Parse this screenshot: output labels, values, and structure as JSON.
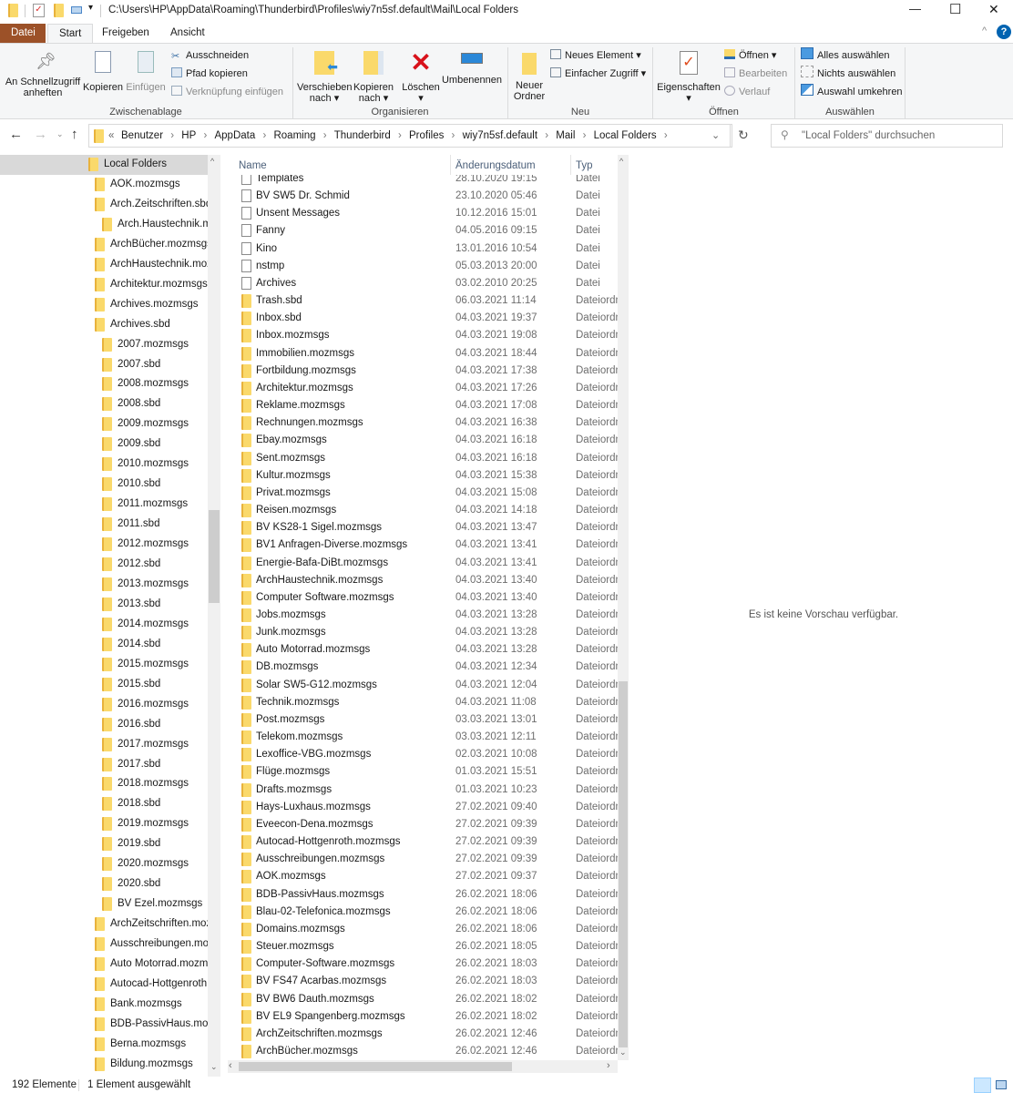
{
  "window": {
    "title": "C:\\Users\\HP\\AppData\\Roaming\\Thunderbird\\Profiles\\wiy7n5sf.default\\Mail\\Local Folders",
    "controls": {
      "minimize": "—",
      "maximize": "☐",
      "close": "✕"
    }
  },
  "ribbon_tabs": [
    {
      "label": "Datei"
    },
    {
      "label": "Start"
    },
    {
      "label": "Freigeben"
    },
    {
      "label": "Ansicht"
    }
  ],
  "ribbon": {
    "clipboard": {
      "pin": "An Schnellzugriff anheften",
      "copy": "Kopieren",
      "paste": "Einfügen",
      "cut": "Ausschneiden",
      "copy_path": "Pfad kopieren",
      "paste_shortcut": "Verknüpfung einfügen",
      "group": "Zwischenablage"
    },
    "organize": {
      "move_to": "Verschieben nach",
      "copy_to": "Kopieren nach",
      "delete": "Löschen",
      "rename": "Umbenennen",
      "group": "Organisieren"
    },
    "new": {
      "new_folder": "Neuer Ordner",
      "new_item": "Neues Element",
      "easy_access": "Einfacher Zugriff",
      "group": "Neu"
    },
    "open": {
      "properties": "Eigenschaften",
      "open": "Öffnen",
      "edit": "Bearbeiten",
      "history": "Verlauf",
      "group": "Öffnen"
    },
    "select": {
      "select_all": "Alles auswählen",
      "select_none": "Nichts auswählen",
      "invert": "Auswahl umkehren",
      "group": "Auswählen"
    }
  },
  "breadcrumb": {
    "overflow": "«",
    "items": [
      "Benutzer",
      "HP",
      "AppData",
      "Roaming",
      "Thunderbird",
      "Profiles",
      "wiy7n5sf.default",
      "Mail",
      "Local Folders"
    ]
  },
  "search": {
    "placeholder": "\"Local Folders\" durchsuchen"
  },
  "nav_pane": {
    "selected": "Local Folders",
    "items": [
      {
        "label": "Local Folders",
        "level": 0
      },
      {
        "label": "AOK.mozmsgs",
        "level": 1
      },
      {
        "label": "Arch.Zeitschriften.sbd",
        "level": 1
      },
      {
        "label": "Arch.Haustechnik.mozmsgs",
        "level": 2
      },
      {
        "label": "ArchBücher.mozmsgs",
        "level": 1
      },
      {
        "label": "ArchHaustechnik.mozmsgs",
        "level": 1
      },
      {
        "label": "Architektur.mozmsgs",
        "level": 1
      },
      {
        "label": "Archives.mozmsgs",
        "level": 1
      },
      {
        "label": "Archives.sbd",
        "level": 1
      },
      {
        "label": "2007.mozmsgs",
        "level": 2
      },
      {
        "label": "2007.sbd",
        "level": 2
      },
      {
        "label": "2008.mozmsgs",
        "level": 2
      },
      {
        "label": "2008.sbd",
        "level": 2
      },
      {
        "label": "2009.mozmsgs",
        "level": 2
      },
      {
        "label": "2009.sbd",
        "level": 2
      },
      {
        "label": "2010.mozmsgs",
        "level": 2
      },
      {
        "label": "2010.sbd",
        "level": 2
      },
      {
        "label": "2011.mozmsgs",
        "level": 2
      },
      {
        "label": "2011.sbd",
        "level": 2
      },
      {
        "label": "2012.mozmsgs",
        "level": 2
      },
      {
        "label": "2012.sbd",
        "level": 2
      },
      {
        "label": "2013.mozmsgs",
        "level": 2
      },
      {
        "label": "2013.sbd",
        "level": 2
      },
      {
        "label": "2014.mozmsgs",
        "level": 2
      },
      {
        "label": "2014.sbd",
        "level": 2
      },
      {
        "label": "2015.mozmsgs",
        "level": 2
      },
      {
        "label": "2015.sbd",
        "level": 2
      },
      {
        "label": "2016.mozmsgs",
        "level": 2
      },
      {
        "label": "2016.sbd",
        "level": 2
      },
      {
        "label": "2017.mozmsgs",
        "level": 2
      },
      {
        "label": "2017.sbd",
        "level": 2
      },
      {
        "label": "2018.mozmsgs",
        "level": 2
      },
      {
        "label": "2018.sbd",
        "level": 2
      },
      {
        "label": "2019.mozmsgs",
        "level": 2
      },
      {
        "label": "2019.sbd",
        "level": 2
      },
      {
        "label": "2020.mozmsgs",
        "level": 2
      },
      {
        "label": "2020.sbd",
        "level": 2
      },
      {
        "label": "BV Ezel.mozmsgs",
        "level": 2
      },
      {
        "label": "ArchZeitschriften.mozmsgs",
        "level": 1
      },
      {
        "label": "Ausschreibungen.mozmsgs",
        "level": 1
      },
      {
        "label": "Auto Motorrad.mozmsgs",
        "level": 1
      },
      {
        "label": "Autocad-Hottgenroth.mozmsgs",
        "level": 1
      },
      {
        "label": "Bank.mozmsgs",
        "level": 1
      },
      {
        "label": "BDB-PassivHaus.mozmsgs",
        "level": 1
      },
      {
        "label": "Berna.mozmsgs",
        "level": 1
      },
      {
        "label": "Bildung.mozmsgs",
        "level": 1
      }
    ]
  },
  "file_list": {
    "columns": {
      "name": "Name",
      "date": "Änderungsdatum",
      "type": "Typ"
    },
    "rows": [
      {
        "name": "Templates",
        "date": "28.10.2020 19:15",
        "type": "Datei",
        "icon": "file"
      },
      {
        "name": "BV SW5 Dr. Schmid",
        "date": "23.10.2020 05:46",
        "type": "Datei",
        "icon": "file"
      },
      {
        "name": "Unsent Messages",
        "date": "10.12.2016 15:01",
        "type": "Datei",
        "icon": "file"
      },
      {
        "name": "Fanny",
        "date": "04.05.2016 09:15",
        "type": "Datei",
        "icon": "file"
      },
      {
        "name": "Kino",
        "date": "13.01.2016 10:54",
        "type": "Datei",
        "icon": "file"
      },
      {
        "name": "nstmp",
        "date": "05.03.2013 20:00",
        "type": "Datei",
        "icon": "file"
      },
      {
        "name": "Archives",
        "date": "03.02.2010 20:25",
        "type": "Datei",
        "icon": "file"
      },
      {
        "name": "Trash.sbd",
        "date": "06.03.2021 11:14",
        "type": "Dateiordner",
        "icon": "folder"
      },
      {
        "name": "Inbox.sbd",
        "date": "04.03.2021 19:37",
        "type": "Dateiordner",
        "icon": "folder"
      },
      {
        "name": "Inbox.mozmsgs",
        "date": "04.03.2021 19:08",
        "type": "Dateiordner",
        "icon": "folder"
      },
      {
        "name": "Immobilien.mozmsgs",
        "date": "04.03.2021 18:44",
        "type": "Dateiordner",
        "icon": "folder"
      },
      {
        "name": "Fortbildung.mozmsgs",
        "date": "04.03.2021 17:38",
        "type": "Dateiordner",
        "icon": "folder"
      },
      {
        "name": "Architektur.mozmsgs",
        "date": "04.03.2021 17:26",
        "type": "Dateiordner",
        "icon": "folder"
      },
      {
        "name": "Reklame.mozmsgs",
        "date": "04.03.2021 17:08",
        "type": "Dateiordner",
        "icon": "folder"
      },
      {
        "name": "Rechnungen.mozmsgs",
        "date": "04.03.2021 16:38",
        "type": "Dateiordner",
        "icon": "folder"
      },
      {
        "name": "Ebay.mozmsgs",
        "date": "04.03.2021 16:18",
        "type": "Dateiordner",
        "icon": "folder"
      },
      {
        "name": "Sent.mozmsgs",
        "date": "04.03.2021 16:18",
        "type": "Dateiordner",
        "icon": "folder"
      },
      {
        "name": "Kultur.mozmsgs",
        "date": "04.03.2021 15:38",
        "type": "Dateiordner",
        "icon": "folder"
      },
      {
        "name": "Privat.mozmsgs",
        "date": "04.03.2021 15:08",
        "type": "Dateiordner",
        "icon": "folder"
      },
      {
        "name": "Reisen.mozmsgs",
        "date": "04.03.2021 14:18",
        "type": "Dateiordner",
        "icon": "folder"
      },
      {
        "name": "BV KS28-1 Sigel.mozmsgs",
        "date": "04.03.2021 13:47",
        "type": "Dateiordner",
        "icon": "folder"
      },
      {
        "name": "BV1 Anfragen-Diverse.mozmsgs",
        "date": "04.03.2021 13:41",
        "type": "Dateiordner",
        "icon": "folder"
      },
      {
        "name": "Energie-Bafa-DiBt.mozmsgs",
        "date": "04.03.2021 13:41",
        "type": "Dateiordner",
        "icon": "folder"
      },
      {
        "name": "ArchHaustechnik.mozmsgs",
        "date": "04.03.2021 13:40",
        "type": "Dateiordner",
        "icon": "folder"
      },
      {
        "name": "Computer Software.mozmsgs",
        "date": "04.03.2021 13:40",
        "type": "Dateiordner",
        "icon": "folder"
      },
      {
        "name": "Jobs.mozmsgs",
        "date": "04.03.2021 13:28",
        "type": "Dateiordner",
        "icon": "folder"
      },
      {
        "name": "Junk.mozmsgs",
        "date": "04.03.2021 13:28",
        "type": "Dateiordner",
        "icon": "folder"
      },
      {
        "name": "Auto Motorrad.mozmsgs",
        "date": "04.03.2021 13:28",
        "type": "Dateiordner",
        "icon": "folder"
      },
      {
        "name": "DB.mozmsgs",
        "date": "04.03.2021 12:34",
        "type": "Dateiordner",
        "icon": "folder"
      },
      {
        "name": "Solar SW5-G12.mozmsgs",
        "date": "04.03.2021 12:04",
        "type": "Dateiordner",
        "icon": "folder"
      },
      {
        "name": "Technik.mozmsgs",
        "date": "04.03.2021 11:08",
        "type": "Dateiordner",
        "icon": "folder"
      },
      {
        "name": "Post.mozmsgs",
        "date": "03.03.2021 13:01",
        "type": "Dateiordner",
        "icon": "folder"
      },
      {
        "name": "Telekom.mozmsgs",
        "date": "03.03.2021 12:11",
        "type": "Dateiordner",
        "icon": "folder"
      },
      {
        "name": "Lexoffice-VBG.mozmsgs",
        "date": "02.03.2021 10:08",
        "type": "Dateiordner",
        "icon": "folder"
      },
      {
        "name": "Flüge.mozmsgs",
        "date": "01.03.2021 15:51",
        "type": "Dateiordner",
        "icon": "folder"
      },
      {
        "name": "Drafts.mozmsgs",
        "date": "01.03.2021 10:23",
        "type": "Dateiordner",
        "icon": "folder"
      },
      {
        "name": "Hays-Luxhaus.mozmsgs",
        "date": "27.02.2021 09:40",
        "type": "Dateiordner",
        "icon": "folder"
      },
      {
        "name": "Eveecon-Dena.mozmsgs",
        "date": "27.02.2021 09:39",
        "type": "Dateiordner",
        "icon": "folder"
      },
      {
        "name": "Autocad-Hottgenroth.mozmsgs",
        "date": "27.02.2021 09:39",
        "type": "Dateiordner",
        "icon": "folder"
      },
      {
        "name": "Ausschreibungen.mozmsgs",
        "date": "27.02.2021 09:39",
        "type": "Dateiordner",
        "icon": "folder"
      },
      {
        "name": "AOK.mozmsgs",
        "date": "27.02.2021 09:37",
        "type": "Dateiordner",
        "icon": "folder"
      },
      {
        "name": "BDB-PassivHaus.mozmsgs",
        "date": "26.02.2021 18:06",
        "type": "Dateiordner",
        "icon": "folder"
      },
      {
        "name": "Blau-02-Telefonica.mozmsgs",
        "date": "26.02.2021 18:06",
        "type": "Dateiordner",
        "icon": "folder"
      },
      {
        "name": "Domains.mozmsgs",
        "date": "26.02.2021 18:06",
        "type": "Dateiordner",
        "icon": "folder"
      },
      {
        "name": "Steuer.mozmsgs",
        "date": "26.02.2021 18:05",
        "type": "Dateiordner",
        "icon": "folder"
      },
      {
        "name": "Computer-Software.mozmsgs",
        "date": "26.02.2021 18:03",
        "type": "Dateiordner",
        "icon": "folder"
      },
      {
        "name": "BV FS47 Acarbas.mozmsgs",
        "date": "26.02.2021 18:03",
        "type": "Dateiordner",
        "icon": "folder"
      },
      {
        "name": "BV BW6 Dauth.mozmsgs",
        "date": "26.02.2021 18:02",
        "type": "Dateiordner",
        "icon": "folder"
      },
      {
        "name": "BV EL9 Spangenberg.mozmsgs",
        "date": "26.02.2021 18:02",
        "type": "Dateiordner",
        "icon": "folder"
      },
      {
        "name": "ArchZeitschriften.mozmsgs",
        "date": "26.02.2021 12:46",
        "type": "Dateiordner",
        "icon": "folder"
      },
      {
        "name": "ArchBücher.mozmsgs",
        "date": "26.02.2021 12:46",
        "type": "Dateiordner",
        "icon": "folder"
      }
    ]
  },
  "preview": {
    "message": "Es ist keine Vorschau verfügbar."
  },
  "status": {
    "count": "192 Elemente",
    "selection": "1 Element ausgewählt"
  },
  "colors": {
    "file_tab": "#9c5128",
    "folder": "#fad96b",
    "selection": "#d9d9d9",
    "accent": "#0063b1"
  }
}
